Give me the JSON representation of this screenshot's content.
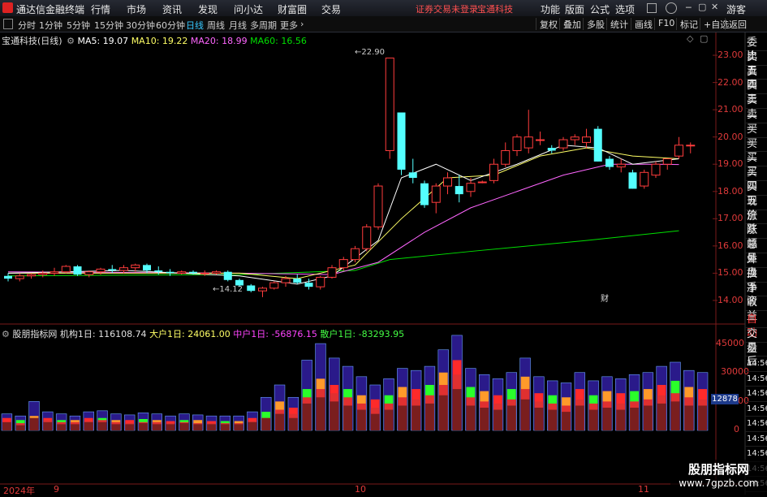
{
  "menubar": {
    "app_title": "通达信金融终端",
    "items": [
      "行情",
      "市场",
      "资讯",
      "发现",
      "问小达",
      "财富圈",
      "交易"
    ],
    "login_status": "证券交易未登录",
    "stock_name": "宝通科技",
    "right_items": [
      "功能",
      "版面",
      "公式",
      "选项"
    ],
    "user": "游客"
  },
  "toolbar": {
    "periods": [
      "分时",
      "1分钟",
      "5分钟",
      "15分钟",
      "30分钟",
      "60分钟",
      "日线",
      "周线",
      "月线",
      "多周期",
      "更多"
    ],
    "active_period": "日线",
    "right_buttons": [
      "复权",
      "叠加",
      "多股",
      "统计",
      "画线",
      "F10",
      "标记",
      "+自选",
      "返回"
    ]
  },
  "chart_header": {
    "title": "宝通科技(日线)",
    "ma5": "MA5: 19.07",
    "ma10": "MA10: 19.22",
    "ma20": "MA20: 18.99",
    "ma60": "MA60: 16.56"
  },
  "indicator_header": {
    "name": "股朋指标网",
    "inst": "机构1日: 116108.74",
    "big": "大户1日: 24061.00",
    "mid": "中户1日: -56876.15",
    "retail": "散户1日: -83293.95"
  },
  "annotations": {
    "high": "22.90",
    "low": "14.12",
    "fin_marker": "财",
    "crosshair_value": "12878"
  },
  "sidebar_top": [
    "委比",
    "卖五",
    "卖四",
    "卖三",
    "卖二",
    "卖一",
    "买一",
    "买二",
    "买三",
    "买四",
    "买五",
    "现价",
    "涨跌",
    "涨幅",
    "总量",
    "外盘",
    "换手",
    "净资",
    "收益"
  ],
  "sidebar_bottom": [
    "自动",
    "交易",
    "盘后",
    "14:56",
    "14:56",
    "14:56",
    "14:56",
    "14:56",
    "14:56",
    "14:56",
    "14:56",
    "14:56"
  ],
  "price_axis": [
    "23.00",
    "22.00",
    "21.00",
    "20.00",
    "19.00",
    "18.00",
    "17.00",
    "16.00",
    "15.00",
    "14.00"
  ],
  "vol_axis": [
    "45000",
    "30000",
    "15000",
    "0"
  ],
  "xaxis": {
    "year": "2024年",
    "m1": "9",
    "m2": "10",
    "m3": "11"
  },
  "watermark": {
    "cn": "股朋指标网",
    "url": "www.7gpzb.com"
  },
  "colors": {
    "up": "#ff3c3c",
    "down": "#54ffff",
    "ma5": "#ffffff",
    "ma10": "#ffff66",
    "ma20": "#ff66ff",
    "ma60": "#00e000"
  },
  "chart_data": {
    "type": "candlestick",
    "candles": [
      [
        14.9,
        15.0,
        14.7,
        14.8
      ],
      [
        14.8,
        15.0,
        14.7,
        14.9
      ],
      [
        14.9,
        15.0,
        14.8,
        14.95
      ],
      [
        14.95,
        15.1,
        14.85,
        15.0
      ],
      [
        15.0,
        15.2,
        14.9,
        15.05
      ],
      [
        15.05,
        15.3,
        15.0,
        15.25
      ],
      [
        15.25,
        15.3,
        14.9,
        14.95
      ],
      [
        14.95,
        15.1,
        14.85,
        15.05
      ],
      [
        15.05,
        15.2,
        14.95,
        15.15
      ],
      [
        15.15,
        15.3,
        15.0,
        15.1
      ],
      [
        15.1,
        15.3,
        15.0,
        15.2
      ],
      [
        15.2,
        15.35,
        15.05,
        15.3
      ],
      [
        15.3,
        15.35,
        15.0,
        15.1
      ],
      [
        15.1,
        15.25,
        14.95,
        15.05
      ],
      [
        15.05,
        15.15,
        14.9,
        15.0
      ],
      [
        15.0,
        15.1,
        14.95,
        15.05
      ],
      [
        15.05,
        15.1,
        14.95,
        15.0
      ],
      [
        15.0,
        15.1,
        14.9,
        15.0
      ],
      [
        15.0,
        15.1,
        14.95,
        15.05
      ],
      [
        15.05,
        15.1,
        14.7,
        14.75
      ],
      [
        14.75,
        14.8,
        14.5,
        14.55
      ],
      [
        14.55,
        14.6,
        14.3,
        14.35
      ],
      [
        14.35,
        14.5,
        14.12,
        14.45
      ],
      [
        14.45,
        14.7,
        14.4,
        14.65
      ],
      [
        14.65,
        14.9,
        14.5,
        14.8
      ],
      [
        14.8,
        14.95,
        14.6,
        14.65
      ],
      [
        14.65,
        14.8,
        14.4,
        14.5
      ],
      [
        14.5,
        14.9,
        14.4,
        14.85
      ],
      [
        14.85,
        15.3,
        14.8,
        15.2
      ],
      [
        15.2,
        15.6,
        15.1,
        15.5
      ],
      [
        15.5,
        16.0,
        15.4,
        15.9
      ],
      [
        15.9,
        16.8,
        15.8,
        16.7
      ],
      [
        16.7,
        18.3,
        16.6,
        18.2
      ],
      [
        19.5,
        22.9,
        19.2,
        22.9
      ],
      [
        20.9,
        20.9,
        18.6,
        18.8
      ],
      [
        18.7,
        19.2,
        18.3,
        18.5
      ],
      [
        18.3,
        18.4,
        17.4,
        17.5
      ],
      [
        17.6,
        18.3,
        17.2,
        18.2
      ],
      [
        18.2,
        18.7,
        17.9,
        18.5
      ],
      [
        18.2,
        18.6,
        17.6,
        17.9
      ],
      [
        18.0,
        18.5,
        17.8,
        18.3
      ],
      [
        18.35,
        18.4,
        18.3,
        18.35
      ],
      [
        18.4,
        19.2,
        18.3,
        19.0
      ],
      [
        19.0,
        19.8,
        18.9,
        19.5
      ],
      [
        19.5,
        20.1,
        19.3,
        20.0
      ],
      [
        19.6,
        21.0,
        19.4,
        20.0
      ],
      [
        19.9,
        20.2,
        19.7,
        19.9
      ],
      [
        19.6,
        19.7,
        19.4,
        19.5
      ],
      [
        19.6,
        20.0,
        19.5,
        19.9
      ],
      [
        19.9,
        20.1,
        19.7,
        20.0
      ],
      [
        19.8,
        20.3,
        19.6,
        20.0
      ],
      [
        20.3,
        20.4,
        19.1,
        19.1
      ],
      [
        19.2,
        19.3,
        18.8,
        18.9
      ],
      [
        18.9,
        19.2,
        18.7,
        19.0
      ],
      [
        18.7,
        18.8,
        18.1,
        18.1
      ],
      [
        18.2,
        18.8,
        18.1,
        18.7
      ],
      [
        18.6,
        19.1,
        18.5,
        19.0
      ],
      [
        19.0,
        19.2,
        18.8,
        19.2
      ],
      [
        19.3,
        20.0,
        19.2,
        19.7
      ],
      [
        19.7,
        19.8,
        19.4,
        19.7
      ]
    ],
    "volume": [
      [
        8000,
        6000,
        4000,
        4000
      ],
      [
        7000,
        5000,
        3500,
        2500
      ],
      [
        14000,
        7000,
        4500,
        6000
      ],
      [
        9000,
        6000,
        5000,
        4000
      ],
      [
        8000,
        5000,
        4000,
        3000
      ],
      [
        7000,
        5000,
        4000,
        3000
      ],
      [
        9000,
        6000,
        4500,
        4000
      ],
      [
        9500,
        6000,
        5000,
        4000
      ],
      [
        8000,
        5000,
        4000,
        3000
      ],
      [
        7500,
        5000,
        3500,
        3000
      ],
      [
        8500,
        5500,
        4000,
        3500
      ],
      [
        8000,
        5000,
        4000,
        3000
      ],
      [
        7000,
        4500,
        3500,
        3000
      ],
      [
        8000,
        5000,
        4000,
        3500
      ],
      [
        7500,
        5000,
        3500,
        3000
      ],
      [
        7000,
        4500,
        3500,
        3000
      ],
      [
        7000,
        4500,
        3500,
        3000
      ],
      [
        7000,
        4500,
        3500,
        3000
      ],
      [
        9000,
        6000,
        4500,
        4000
      ],
      [
        16000,
        9000,
        6000,
        6000
      ],
      [
        22000,
        14000,
        10000,
        8000
      ],
      [
        16000,
        11000,
        8000,
        6000
      ],
      [
        34000,
        20000,
        16000,
        13000
      ],
      [
        42000,
        25000,
        20000,
        16000
      ],
      [
        35000,
        22000,
        18000,
        14000
      ],
      [
        31000,
        20000,
        16000,
        12000
      ],
      [
        26000,
        17000,
        13000,
        10000
      ],
      [
        22000,
        15000,
        11000,
        8000
      ],
      [
        25000,
        17000,
        13000,
        10000
      ],
      [
        30000,
        21000,
        16000,
        12000
      ],
      [
        29000,
        20000,
        15000,
        12000
      ],
      [
        31000,
        22000,
        17000,
        13000
      ],
      [
        39000,
        28000,
        22000,
        17000
      ],
      [
        46000,
        34000,
        27000,
        20000
      ],
      [
        30000,
        21000,
        16000,
        12000
      ],
      [
        27000,
        19000,
        14000,
        11000
      ],
      [
        25000,
        17000,
        13000,
        10000
      ],
      [
        28000,
        20000,
        15000,
        12000
      ],
      [
        35000,
        26000,
        20000,
        15000
      ],
      [
        26000,
        18000,
        14000,
        11000
      ],
      [
        24000,
        17000,
        13000,
        10000
      ],
      [
        23000,
        16000,
        12000,
        9000
      ],
      [
        28000,
        20000,
        15000,
        12000
      ],
      [
        24000,
        17000,
        13000,
        10000
      ],
      [
        26000,
        19000,
        14000,
        11000
      ],
      [
        25000,
        18000,
        13000,
        10000
      ],
      [
        27000,
        19000,
        14000,
        11000
      ],
      [
        28000,
        20000,
        15000,
        12000
      ],
      [
        31000,
        22000,
        17000,
        13000
      ],
      [
        33000,
        24000,
        18000,
        14000
      ],
      [
        29000,
        21000,
        16000,
        12000
      ],
      [
        28000,
        20000,
        15000,
        12000
      ]
    ],
    "ma": {
      "ma5": [
        [
          0,
          15.0
        ],
        [
          10,
          15.1
        ],
        [
          20,
          14.9
        ],
        [
          25,
          14.6
        ],
        [
          28,
          14.9
        ],
        [
          32,
          16.2
        ],
        [
          34,
          18.5
        ],
        [
          37,
          19.0
        ],
        [
          40,
          18.4
        ],
        [
          44,
          19.0
        ],
        [
          48,
          19.7
        ],
        [
          51,
          19.6
        ],
        [
          54,
          19.0
        ],
        [
          58,
          19.2
        ]
      ],
      "ma10": [
        [
          0,
          15.0
        ],
        [
          20,
          15.0
        ],
        [
          25,
          14.8
        ],
        [
          30,
          15.3
        ],
        [
          34,
          17.0
        ],
        [
          38,
          18.5
        ],
        [
          42,
          18.6
        ],
        [
          46,
          19.3
        ],
        [
          50,
          19.6
        ],
        [
          54,
          19.3
        ],
        [
          58,
          19.2
        ]
      ],
      "ma20": [
        [
          0,
          15.05
        ],
        [
          20,
          15.0
        ],
        [
          28,
          14.95
        ],
        [
          32,
          15.4
        ],
        [
          36,
          16.5
        ],
        [
          40,
          17.4
        ],
        [
          44,
          18.0
        ],
        [
          48,
          18.6
        ],
        [
          52,
          19.0
        ],
        [
          56,
          19.0
        ],
        [
          58,
          18.99
        ]
      ],
      "ma60": [
        [
          0,
          14.9
        ],
        [
          20,
          14.95
        ],
        [
          30,
          15.1
        ],
        [
          33,
          15.5
        ],
        [
          40,
          15.8
        ],
        [
          50,
          16.2
        ],
        [
          58,
          16.56
        ]
      ]
    },
    "price_range": [
      13.7,
      23.3
    ],
    "vol_max": 55000
  }
}
